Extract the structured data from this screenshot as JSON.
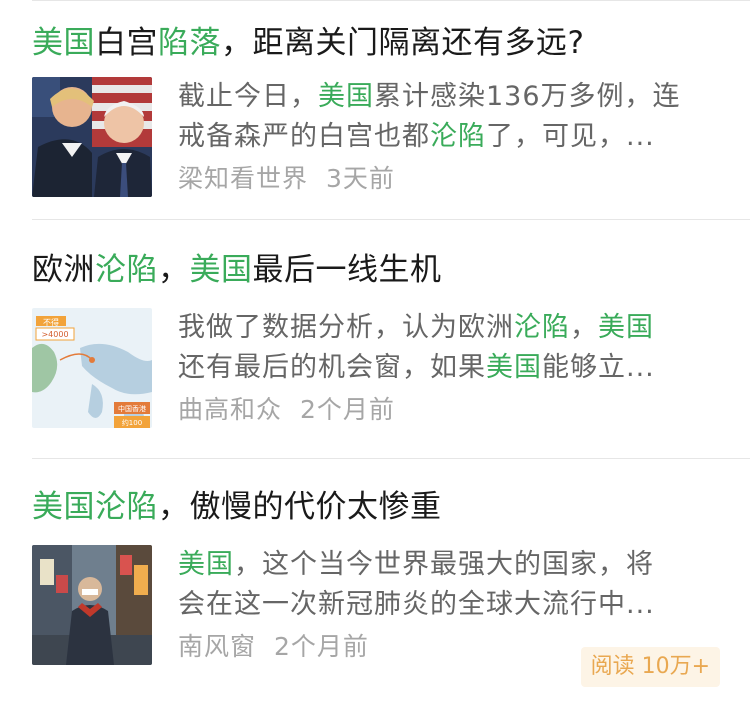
{
  "articles": [
    {
      "title_parts": [
        {
          "text": "美国",
          "hl": true
        },
        {
          "text": "白宫",
          "hl": false
        },
        {
          "text": "陷落",
          "hl": true
        },
        {
          "text": "，距离关门隔离还有多远?",
          "hl": false
        }
      ],
      "summary_line1": [
        {
          "text": "截止今日，",
          "hl": false
        },
        {
          "text": "美国",
          "hl": true
        },
        {
          "text": "累计感染136万多例，连",
          "hl": false
        }
      ],
      "summary_line2": [
        {
          "text": "戒备森严的白宫也都",
          "hl": false
        },
        {
          "text": "沦陷",
          "hl": true
        },
        {
          "text": "了，可见，...",
          "hl": false
        }
      ],
      "source": "梁知看世界",
      "time": "3天前"
    },
    {
      "title_parts": [
        {
          "text": "欧洲",
          "hl": false
        },
        {
          "text": "沦陷",
          "hl": true
        },
        {
          "text": "，",
          "hl": false
        },
        {
          "text": "美国",
          "hl": true
        },
        {
          "text": "最后一线生机",
          "hl": false
        }
      ],
      "summary_line1": [
        {
          "text": "我做了数据分析，认为欧洲",
          "hl": false
        },
        {
          "text": "沦陷",
          "hl": true
        },
        {
          "text": "，",
          "hl": false
        },
        {
          "text": "美国",
          "hl": true
        }
      ],
      "summary_line2": [
        {
          "text": "还有最后的机会窗，如果",
          "hl": false
        },
        {
          "text": "美国",
          "hl": true
        },
        {
          "text": "能够立...",
          "hl": false
        }
      ],
      "source": "曲高和众",
      "time": "2个月前",
      "thumb_labels": {
        "a": "不得",
        "b": ">4000",
        "c": "中国香港",
        "d": "约100"
      }
    },
    {
      "title_parts": [
        {
          "text": "美国",
          "hl": true
        },
        {
          "text": "沦陷",
          "hl": true
        },
        {
          "text": "，傲慢的代价太惨重",
          "hl": false
        }
      ],
      "summary_line1": [
        {
          "text": "美国",
          "hl": true
        },
        {
          "text": "，这个当今世界最强大的国家，将",
          "hl": false
        }
      ],
      "summary_line2": [
        {
          "text": "会在这一次新冠肺炎的全球大流行中...",
          "hl": false
        }
      ],
      "source": "南风窗",
      "time": "2个月前",
      "read_badge": "阅读 10万+"
    }
  ],
  "colors": {
    "highlight": "#3aab5a",
    "summary": "#666666",
    "meta": "#a6a6a6",
    "badge_text": "#e9a851",
    "badge_bg": "#fdf4e6"
  }
}
